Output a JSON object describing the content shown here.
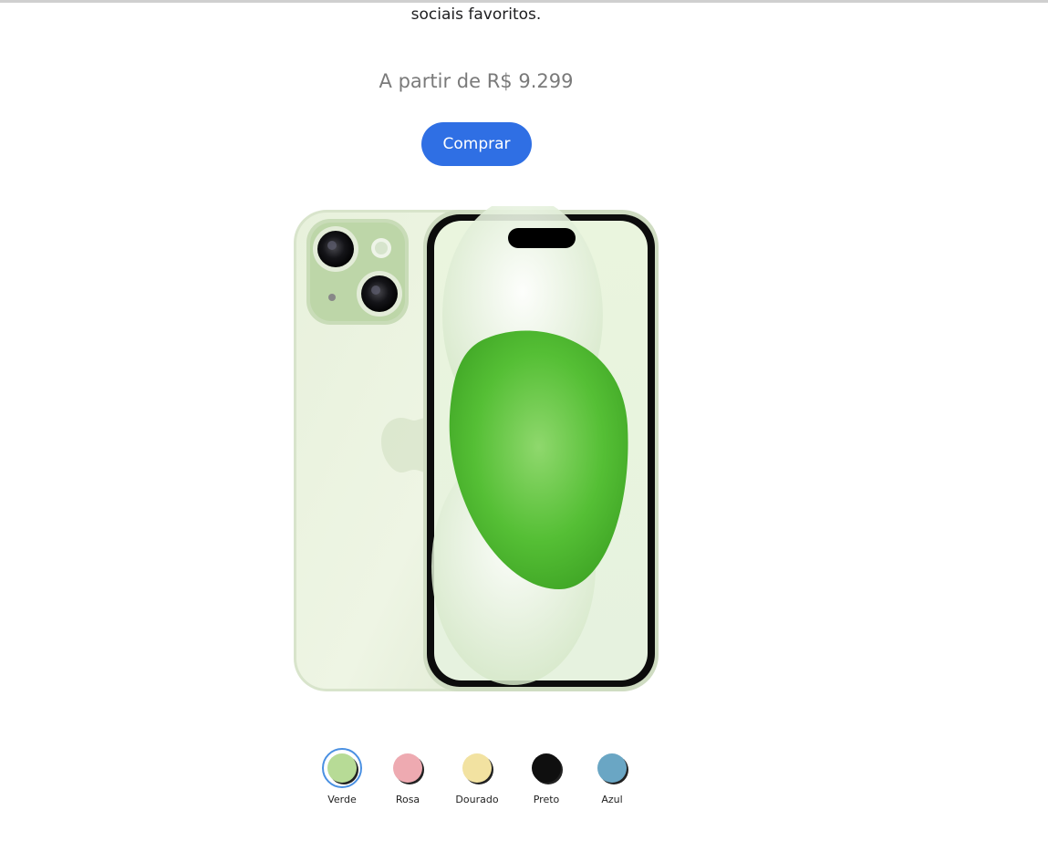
{
  "product": {
    "description_tail": "sociais favoritos.",
    "price": "A partir de R$ 9.299",
    "buy_label": "Comprar"
  },
  "colors": [
    {
      "name": "Verde",
      "hex": "#b7db96",
      "selected": true
    },
    {
      "name": "Rosa",
      "hex": "#eeaab1",
      "selected": false
    },
    {
      "name": "Dourado",
      "hex": "#f2e2a1",
      "selected": false
    },
    {
      "name": "Preto",
      "hex": "#0f0f0f",
      "selected": false
    },
    {
      "name": "Azul",
      "hex": "#6aa6c4",
      "selected": false
    }
  ],
  "image": {
    "icon": "phone-image"
  }
}
